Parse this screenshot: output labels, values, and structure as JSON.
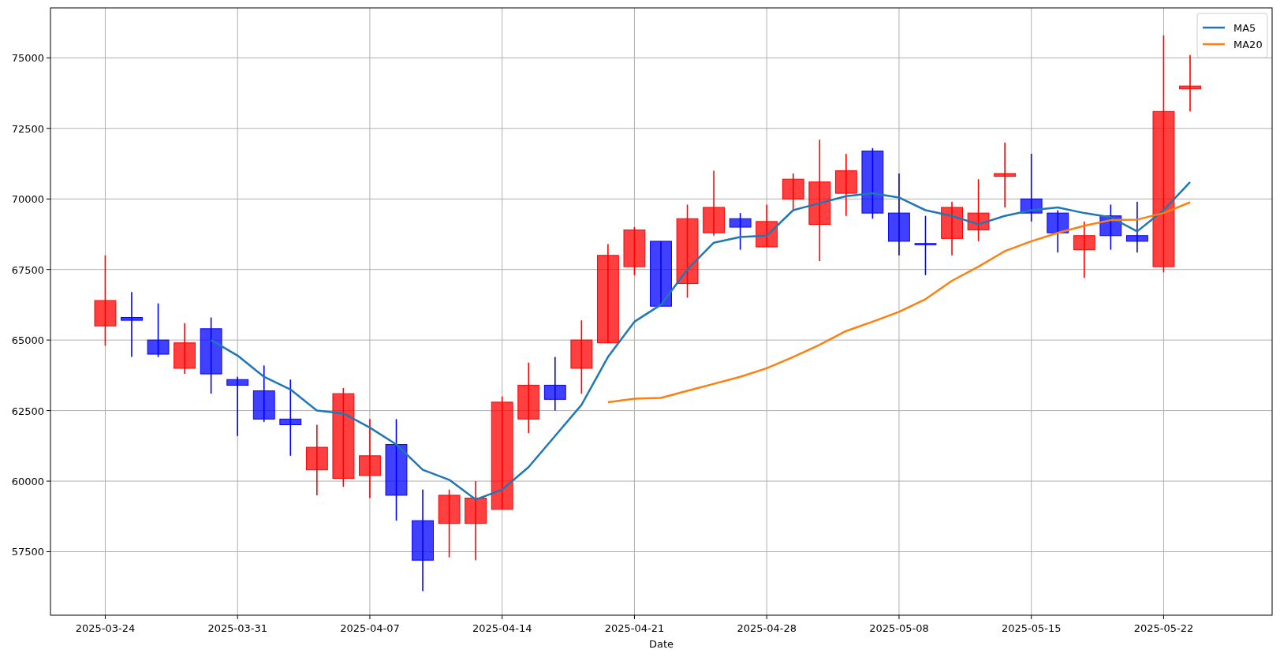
{
  "chart_data": {
    "type": "candlestick",
    "xlabel": "Date",
    "categories": [
      "2025-03-24",
      null,
      null,
      null,
      null,
      "2025-03-31",
      null,
      null,
      null,
      null,
      "2025-04-07",
      null,
      null,
      null,
      null,
      "2025-04-14",
      null,
      null,
      null,
      null,
      "2025-04-21",
      null,
      null,
      null,
      null,
      "2025-04-28",
      null,
      null,
      null,
      null,
      "2025-05-08",
      null,
      null,
      null,
      null,
      "2025-05-15",
      null,
      null,
      null,
      null,
      "2025-05-22",
      null
    ],
    "ohlc": [
      [
        65500,
        68000,
        64800,
        66400
      ],
      [
        65800,
        66700,
        64400,
        65700
      ],
      [
        65000,
        66300,
        64400,
        64500
      ],
      [
        64000,
        65600,
        63800,
        64900
      ],
      [
        65400,
        65800,
        63100,
        63800
      ],
      [
        63600,
        63700,
        61600,
        63400
      ],
      [
        63200,
        64100,
        62100,
        62200
      ],
      [
        62200,
        63600,
        60900,
        62000
      ],
      [
        60400,
        62000,
        59500,
        61200
      ],
      [
        60100,
        63300,
        59800,
        63100
      ],
      [
        60200,
        62200,
        59400,
        60900
      ],
      [
        61300,
        62200,
        58600,
        59500
      ],
      [
        58600,
        59700,
        56100,
        57200
      ],
      [
        58500,
        59700,
        57300,
        59500
      ],
      [
        58500,
        60000,
        57200,
        59400
      ],
      [
        59000,
        63000,
        59000,
        62800
      ],
      [
        62200,
        64200,
        61700,
        63400
      ],
      [
        63400,
        64400,
        62500,
        62900
      ],
      [
        64000,
        65700,
        63100,
        65000
      ],
      [
        64900,
        68400,
        64900,
        68000
      ],
      [
        67600,
        69000,
        67300,
        68900
      ],
      [
        68500,
        68500,
        66200,
        66200
      ],
      [
        67000,
        69800,
        66500,
        69300
      ],
      [
        68800,
        71000,
        68700,
        69700
      ],
      [
        69300,
        69500,
        68200,
        69000
      ],
      [
        68300,
        69800,
        68300,
        69200
      ],
      [
        70000,
        70900,
        69600,
        70700
      ],
      [
        69100,
        72100,
        67800,
        70600
      ],
      [
        70200,
        71600,
        69400,
        71000
      ],
      [
        71700,
        71800,
        69300,
        69500
      ],
      [
        69500,
        70900,
        68000,
        68500
      ],
      [
        68420,
        69400,
        67300,
        68380
      ],
      [
        68600,
        69900,
        68000,
        69700
      ],
      [
        68900,
        70700,
        68500,
        69500
      ],
      [
        70800,
        72000,
        69700,
        70900
      ],
      [
        70000,
        71600,
        69200,
        69500
      ],
      [
        69500,
        69600,
        68100,
        68800
      ],
      [
        68200,
        69200,
        67200,
        68700
      ],
      [
        69400,
        69800,
        68200,
        68700
      ],
      [
        68700,
        69900,
        68100,
        68500
      ],
      [
        67600,
        75800,
        67400,
        73100
      ],
      [
        73900,
        75100,
        73100,
        74000
      ]
    ],
    "series": [
      {
        "name": "MA5",
        "type": "line",
        "color": "#1f77b4",
        "values": [
          null,
          null,
          null,
          null,
          65000,
          64450,
          63700,
          63250,
          62500,
          62400,
          61900,
          61300,
          60400,
          60050,
          59350,
          59700,
          60500,
          61600,
          62700,
          64400,
          65650,
          66250,
          67500,
          68450,
          68650,
          68700,
          69600,
          69850,
          70100,
          70200,
          70050,
          69600,
          69400,
          69100,
          69400,
          69600,
          69700,
          69500,
          69350,
          68850,
          69600,
          70600
        ]
      },
      {
        "name": "MA20",
        "type": "line",
        "color": "#ff7f0e",
        "values": [
          null,
          null,
          null,
          null,
          null,
          null,
          null,
          null,
          null,
          null,
          null,
          null,
          null,
          null,
          null,
          null,
          null,
          null,
          null,
          62800,
          62920,
          62950,
          63200,
          63450,
          63700,
          64000,
          64400,
          64830,
          65320,
          65650,
          66000,
          66450,
          67100,
          67600,
          68150,
          68500,
          68800,
          69050,
          69250,
          69270,
          69500,
          69880
        ]
      }
    ],
    "ylim": [
      55250,
      76770
    ],
    "grid": true,
    "legend": true,
    "yticks": [
      57500,
      60000,
      62500,
      65000,
      67500,
      70000,
      72500,
      75000
    ]
  }
}
